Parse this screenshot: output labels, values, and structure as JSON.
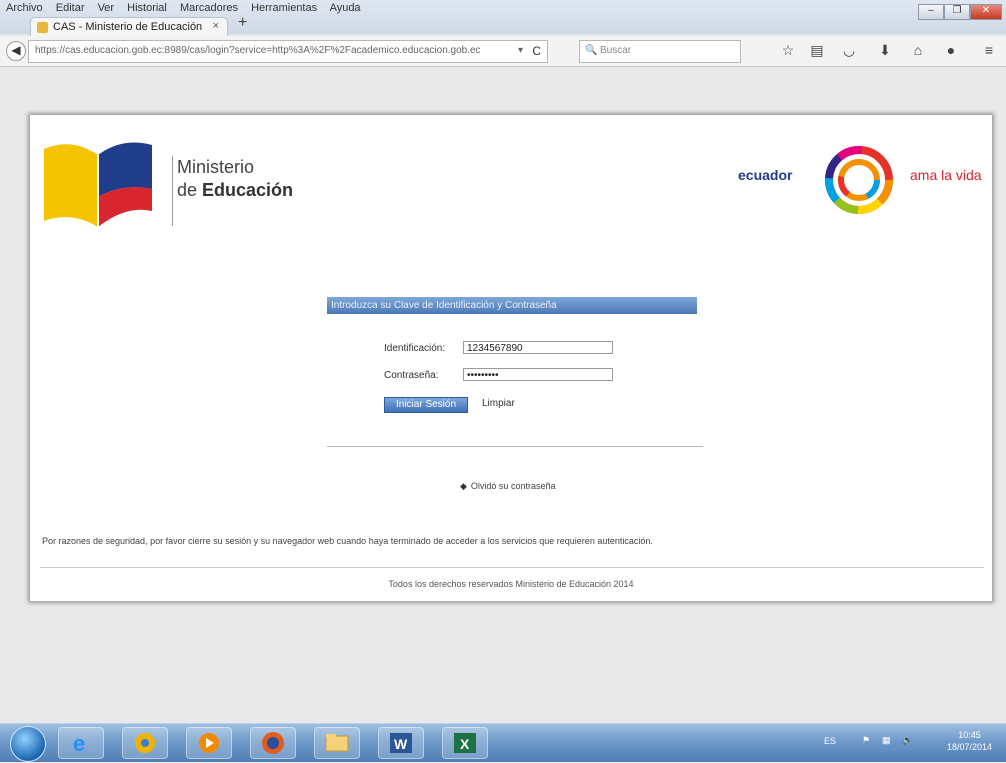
{
  "browser": {
    "menu_items": [
      "Archivo",
      "Editar",
      "Ver",
      "Historial",
      "Marcadores",
      "Herramientas",
      "Ayuda"
    ],
    "tab_title": "CAS - Ministerio de Educación",
    "tab_close": "×",
    "new_tab": "+",
    "url": "https://cas.educacion.gob.ec:8989/cas/login?service=http%3A%2F%2Facademico.educacion.gob.ec",
    "url_dropdown": "▾",
    "reload": "C",
    "search_placeholder": "Buscar"
  },
  "page": {
    "brand_line1": "Ministerio",
    "brand_line2_prefix": "de ",
    "brand_line2_bold": "Educación",
    "slogan_left": "ecuador",
    "slogan_right": "ama la vida",
    "panel_title": "Introduzca su Clave de Identificación y Contraseña",
    "username_label": "Identificación:",
    "username_value": "1234567890",
    "password_label": "Contraseña:",
    "password_value": "•••••••••",
    "submit_label": "Iniciar Sesión",
    "clear_label": "Limpiar",
    "forgot_link": "Olvidó su contraseña",
    "notice": "Por razones de seguridad, por favor cierre su sesión y su navegador web cuando haya terminado de acceder a los servicios que requieren autenticación.",
    "footer": "Todos los derechos reservados Ministerio de Educación 2014"
  },
  "taskbar": {
    "apps": [
      "windows-start",
      "internet-explorer",
      "chrome",
      "media-player",
      "firefox",
      "file-explorer",
      "word",
      "excel"
    ],
    "language": "ES",
    "time": "10:45",
    "date": "18/07/2014"
  },
  "colors": {
    "panel_header": "#4a79b8",
    "brand_blue": "#1f3d8a",
    "brand_red": "#d9262e",
    "flag_yellow": "#f5c400"
  }
}
